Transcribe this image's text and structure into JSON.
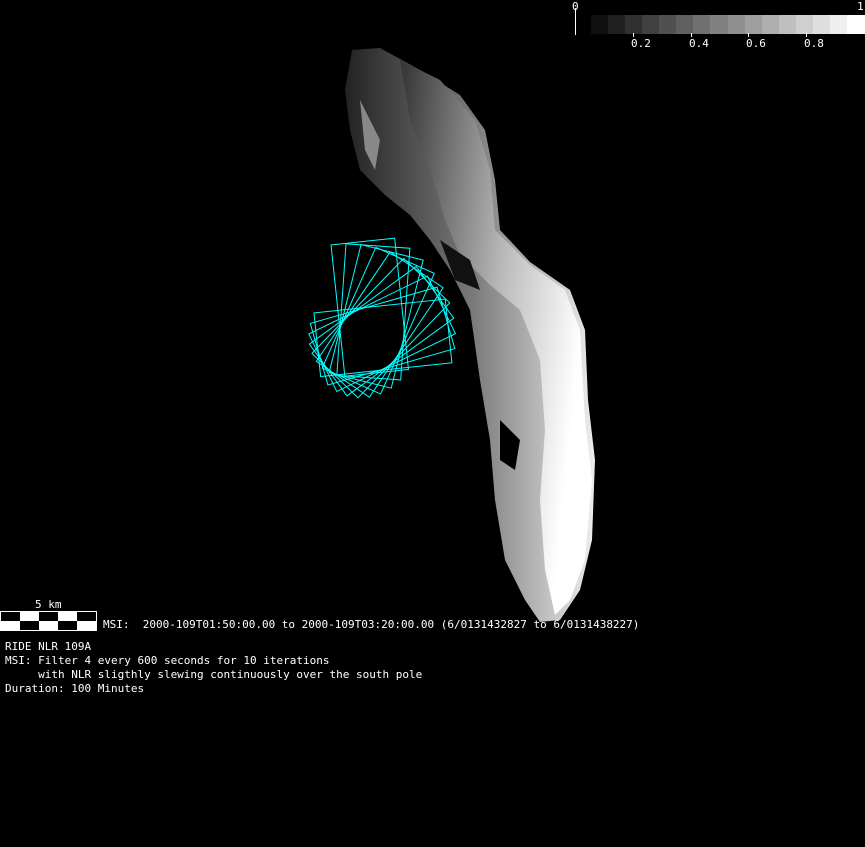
{
  "colorbar": {
    "min_label": "0",
    "max_label": "1",
    "tick_labels": [
      "0.2",
      "0.4",
      "0.6",
      "0.8"
    ],
    "steps": 16
  },
  "scale_bar": {
    "label": "5 km"
  },
  "time_range": "MSI:  2000-109T01:50:00.00 to 2000-109T03:20:00.00 (6/0131432827 to 6/0131438227)",
  "notes": [
    "RIDE NLR 109A",
    "MSI: Filter 4 every 600 seconds for 10 iterations",
    "     with NLR sligthly slewing continuously over the south pole",
    "Duration: 100 Minutes"
  ],
  "colors": {
    "footprint": "#00ffff",
    "background": "#000000"
  }
}
